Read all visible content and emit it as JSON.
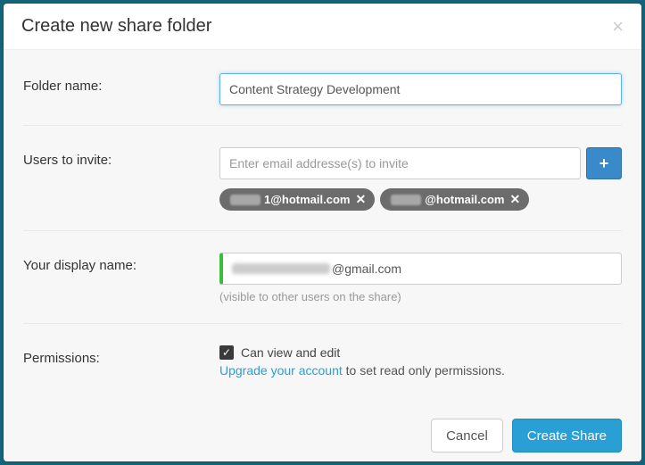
{
  "modal": {
    "title": "Create new share folder"
  },
  "folderName": {
    "label": "Folder name:",
    "value": "Content Strategy Development"
  },
  "usersInvite": {
    "label": "Users to invite:",
    "placeholder": "Enter email addresse(s) to invite",
    "chips": [
      {
        "hiddenWidth": "34px",
        "visible": "1@hotmail.com"
      },
      {
        "hiddenWidth": "34px",
        "visible": "@hotmail.com"
      }
    ]
  },
  "displayName": {
    "label": "Your display name:",
    "visibleSuffix": "@gmail.com",
    "hint": "(visible to other users on the share)"
  },
  "permissions": {
    "label": "Permissions:",
    "checkboxLabel": "Can view and edit",
    "upgradeLink": "Upgrade your account",
    "upgradeTail": " to set read only permissions."
  },
  "buttons": {
    "cancel": "Cancel",
    "create": "Create Share"
  }
}
